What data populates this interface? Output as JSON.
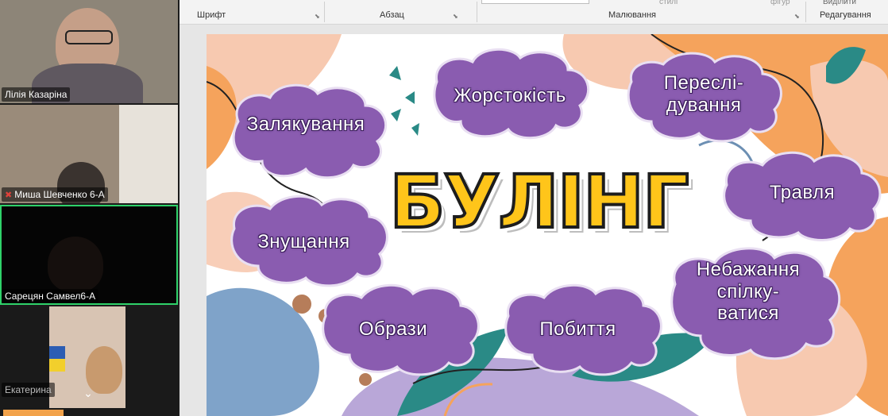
{
  "participants": [
    {
      "name": "Лілія Казаріна",
      "muted": false
    },
    {
      "name": "Миша Шевченко 6-А",
      "muted": true
    },
    {
      "name": "Сарецян Самвел6-А",
      "muted": false,
      "active_speaker": true
    },
    {
      "name": "Екатерина",
      "muted": false
    }
  ],
  "ribbon": {
    "groups": [
      "Шрифт",
      "Абзац",
      "Малювання",
      "Редагування"
    ],
    "truncated_text": [
      "стилі",
      "фігур",
      "Виділити"
    ]
  },
  "slide": {
    "title": "БУЛІНГ",
    "clouds": [
      {
        "lines": [
          "Залякування"
        ]
      },
      {
        "lines": [
          "Жорстокість"
        ]
      },
      {
        "lines": [
          "Переслі-",
          "дування"
        ]
      },
      {
        "lines": [
          "Травля"
        ]
      },
      {
        "lines": [
          "Знущання"
        ]
      },
      {
        "lines": [
          "Образи"
        ]
      },
      {
        "lines": [
          "Побиття"
        ]
      },
      {
        "lines": [
          "Небажання",
          "спілку-",
          "ватися"
        ]
      }
    ],
    "colors": {
      "cloud_fill": "#8a5cb0",
      "cloud_stroke": "#e9dff2",
      "title_fill": "#ffc51a",
      "peach": "#f7c9b0",
      "orange": "#f5a35c",
      "teal": "#2a8a86",
      "lavender": "#b9a7d8",
      "blue": "#7fa3c9"
    }
  },
  "icons": {
    "mic": "mic-off-icon",
    "expand": "chevron-down-icon",
    "launcher": "dialog-launcher-icon"
  }
}
